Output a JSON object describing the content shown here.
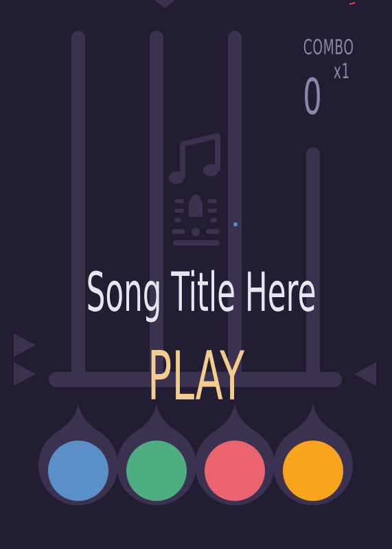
{
  "hud": {
    "combo_label": "COMBO x1",
    "score": "0"
  },
  "song": {
    "title": "Song Title Here"
  },
  "play_label": "PLAY",
  "icons": {
    "music": "music-note-icon",
    "metronome": "metronome-icon",
    "arrow_right": "triangle-right-icon",
    "arrow_left": "triangle-left-icon"
  },
  "colors": {
    "background": "#231d34",
    "track": "#3b3150",
    "button_1": "#5b8fc7",
    "button_2": "#4fad82",
    "button_3": "#e9646f",
    "button_4": "#f8a51d",
    "title_text": "#e6e6ef",
    "play_text": "#f3cc8e",
    "hud_text": "#8a87aa"
  },
  "buttons": [
    {
      "name": "lane-1-button",
      "color": "#5b8fc7"
    },
    {
      "name": "lane-2-button",
      "color": "#4fad82"
    },
    {
      "name": "lane-3-button",
      "color": "#e9646f"
    },
    {
      "name": "lane-4-button",
      "color": "#f8a51d"
    }
  ]
}
